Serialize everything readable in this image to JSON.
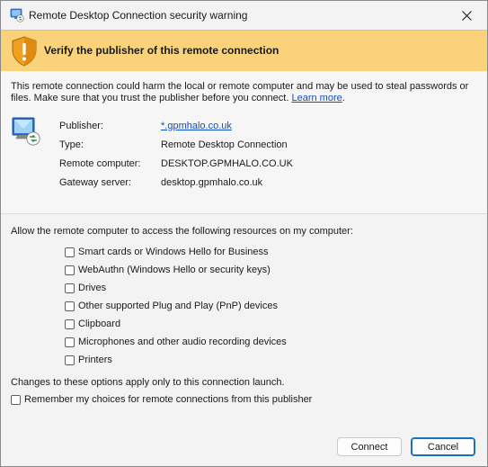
{
  "window": {
    "title": "Remote Desktop Connection security warning",
    "close_label": "close"
  },
  "banner": {
    "heading": "Verify the publisher of this remote connection",
    "color": "#fad27a"
  },
  "description": {
    "text": "This remote connection could harm the local or remote computer and may be used to steal passwords or files. Make sure that you trust the publisher before you connect.",
    "link_text": "Learn more",
    "trailing": "."
  },
  "details": [
    {
      "label": "Publisher:",
      "value": "*.gpmhalo.co.uk",
      "is_link": true
    },
    {
      "label": "Type:",
      "value": "Remote Desktop Connection",
      "is_link": false
    },
    {
      "label": "Remote computer:",
      "value": "DESKTOP.GPMHALO.CO.UK",
      "is_link": false
    },
    {
      "label": "Gateway server:",
      "value": "desktop.gpmhalo.co.uk",
      "is_link": false
    }
  ],
  "resources": {
    "heading": "Allow the remote computer to access the following resources on my computer:",
    "items": [
      {
        "label": "Smart cards or Windows Hello for Business",
        "checked": false
      },
      {
        "label": "WebAuthn (Windows Hello or security keys)",
        "checked": false
      },
      {
        "label": "Drives",
        "checked": false
      },
      {
        "label": "Other supported Plug and Play (PnP) devices",
        "checked": false
      },
      {
        "label": "Clipboard",
        "checked": false
      },
      {
        "label": "Microphones and other audio recording devices",
        "checked": false
      },
      {
        "label": "Printers",
        "checked": false
      }
    ]
  },
  "footer": {
    "note": "Changes to these options apply only to this connection launch.",
    "remember_label": "Remember my choices for remote connections from this publisher",
    "remember_checked": false
  },
  "buttons": {
    "connect": "Connect",
    "cancel": "Cancel"
  },
  "icons": {
    "title": "remote-desktop-icon",
    "banner": "warning-shield-icon",
    "computer": "computer-monitor-icon",
    "close": "close-icon"
  }
}
